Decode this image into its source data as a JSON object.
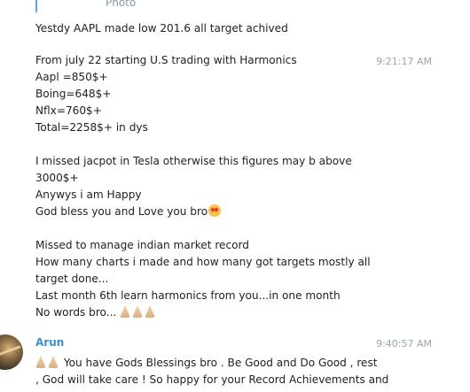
{
  "reply": {
    "label": "Photo"
  },
  "messages": {
    "m1": {
      "text": "Yestdy AAPL made low 201.6 all target achived"
    },
    "m2": {
      "time": "9:21:17 AM",
      "lines": [
        "From july 22 starting U.S trading with Harmonics",
        "Aapl =850$+",
        "Boing=648$+",
        "Nflx=760$+",
        "Total=2258$+ in dys",
        "",
        "I missed jacpot in Tesla otherwise this figures may b above",
        "3000$+",
        "Anywys i am Happy",
        "God bless you and Love you bro",
        "",
        "Missed to manage indian market record",
        "How many charts i made and how many got targets mostly all",
        "target done...",
        "Last month 6th learn harmonics from you...in one month",
        "No words bro..."
      ]
    },
    "m3": {
      "sender": "Arun",
      "time": "9:40:57 AM",
      "lines": [
        "You have Gods Blessings bro . Be Good and Do Good , rest",
        ", God will take care ! So happy for your Record Achievements and"
      ]
    }
  },
  "icons": {
    "face": "heart-eyes-emoji",
    "pray": "folded-hands-emoji"
  }
}
